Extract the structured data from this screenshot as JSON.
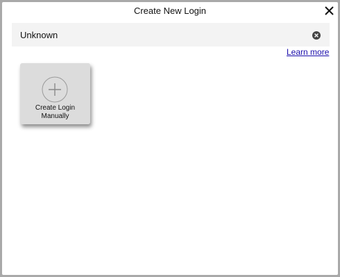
{
  "dialog": {
    "title": "Create New Login",
    "close_icon": "close-icon"
  },
  "search": {
    "value": "Unknown",
    "clear_icon": "clear-circle-icon"
  },
  "learn_more_label": "Learn more",
  "tiles": [
    {
      "label": "Create Login\nManually",
      "icon": "plus-circle-icon"
    }
  ],
  "colors": {
    "link": "#1a0dab",
    "tile_bg": "#dcdcdc",
    "search_bg": "#f3f3f3"
  }
}
